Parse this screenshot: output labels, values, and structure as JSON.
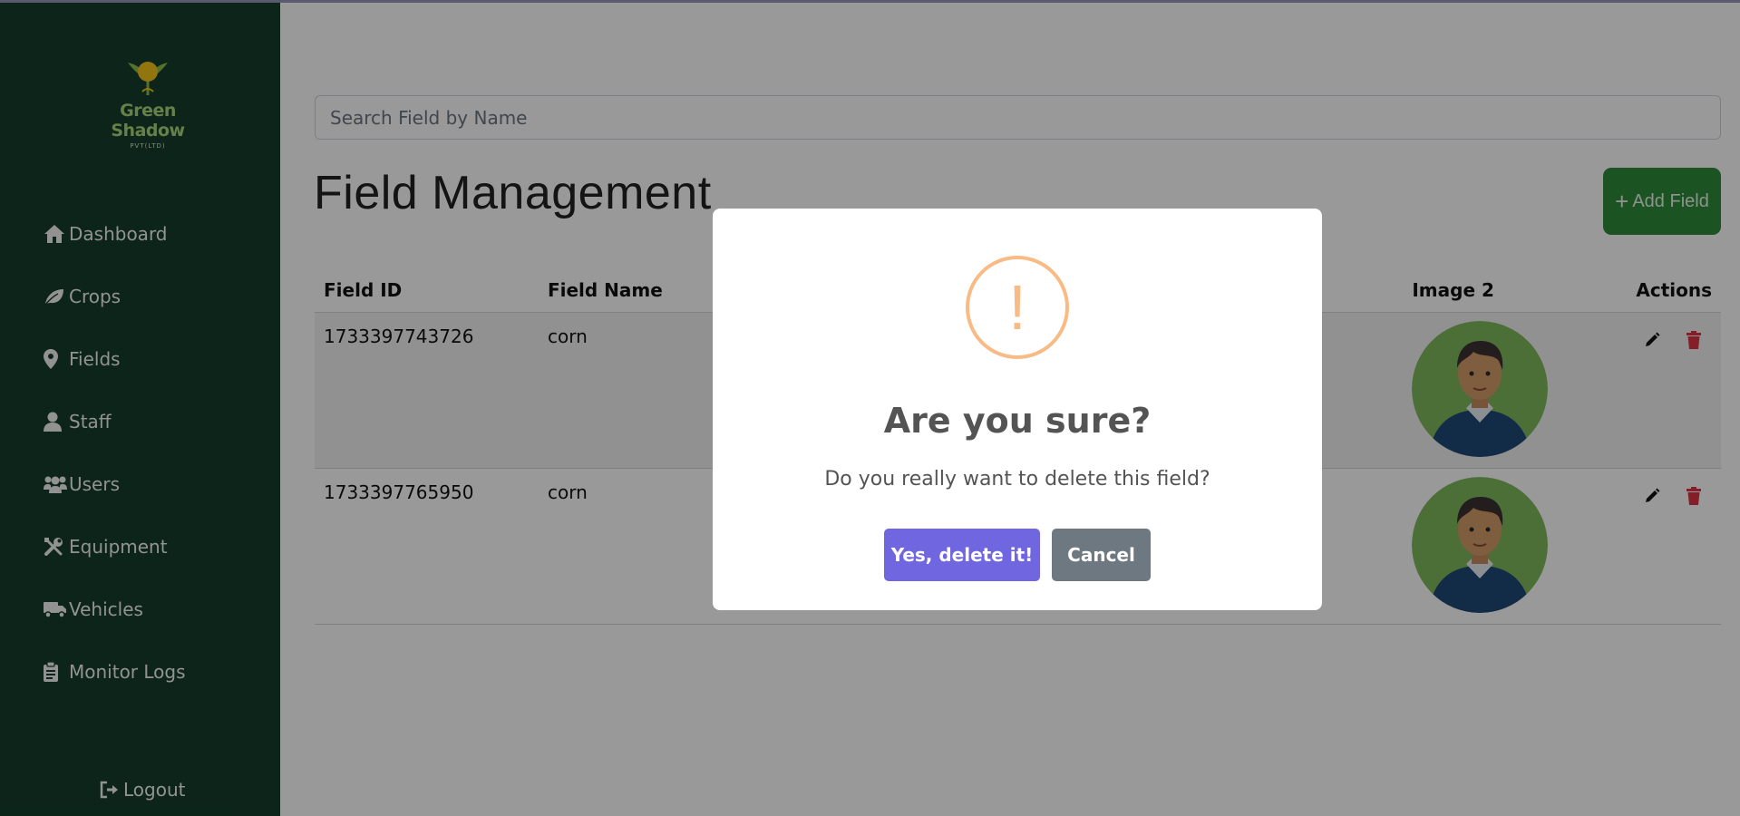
{
  "logo": {
    "name": "Green Shadow",
    "sub": "PVT(LTD)"
  },
  "sidebar": {
    "items": [
      {
        "label": "Dashboard",
        "icon": "home-icon"
      },
      {
        "label": "Crops",
        "icon": "leaf-icon"
      },
      {
        "label": "Fields",
        "icon": "map-pin-icon"
      },
      {
        "label": "Staff",
        "icon": "user-icon"
      },
      {
        "label": "Users",
        "icon": "users-icon"
      },
      {
        "label": "Equipment",
        "icon": "tools-icon"
      },
      {
        "label": "Vehicles",
        "icon": "truck-icon"
      },
      {
        "label": "Monitor Logs",
        "icon": "clipboard-icon"
      }
    ],
    "logout": "Logout"
  },
  "search": {
    "placeholder": "Search Field by Name"
  },
  "page": {
    "title": "Field Management",
    "add_label": "Add Field"
  },
  "table": {
    "headers": {
      "id": "Field ID",
      "name": "Field Name",
      "image2": "Image 2",
      "actions": "Actions"
    },
    "rows": [
      {
        "id": "1733397743726",
        "name": "corn"
      },
      {
        "id": "1733397765950",
        "name": "corn"
      }
    ]
  },
  "modal": {
    "icon": "!",
    "title": "Are you sure?",
    "text": "Do you really want to delete this field?",
    "confirm": "Yes, delete it!",
    "cancel": "Cancel"
  },
  "colors": {
    "sidebar": "#143d2a",
    "add_button": "#2e8b3b",
    "confirm_button": "#7066e0",
    "cancel_button": "#6e7881",
    "warning": "#f8bb86",
    "delete_icon": "#dc3545"
  }
}
